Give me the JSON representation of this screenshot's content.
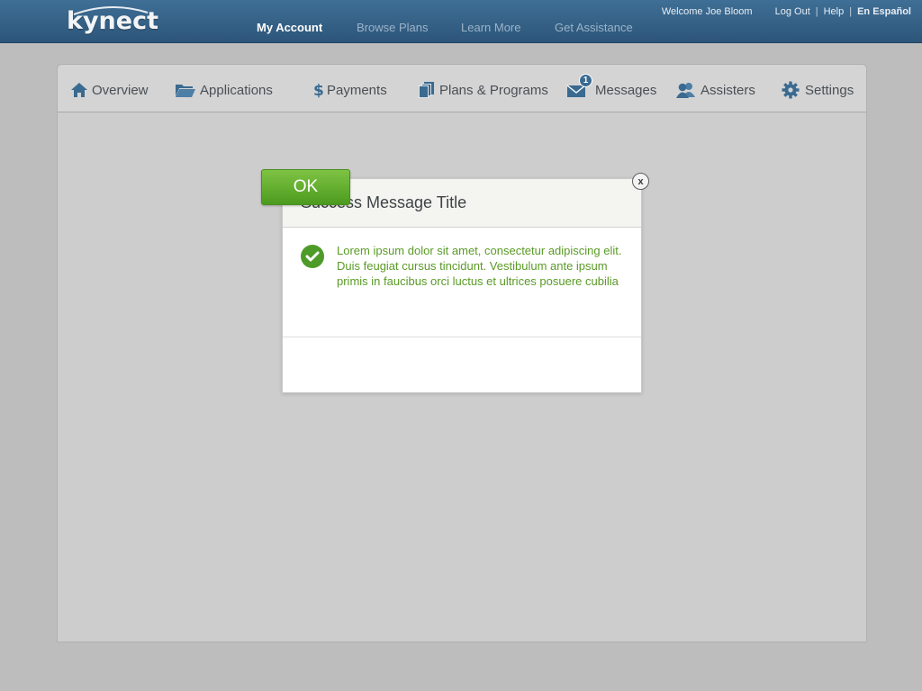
{
  "header": {
    "logo_text": "kynect",
    "nav": [
      {
        "label": "My Account",
        "active": true
      },
      {
        "label": "Browse Plans",
        "active": false
      },
      {
        "label": "Learn More",
        "active": false
      },
      {
        "label": "Get Assistance",
        "active": false
      }
    ],
    "welcome": "Welcome Joe Bloom",
    "logout": "Log Out",
    "help": "Help",
    "separator": "|",
    "language": "En Español"
  },
  "tabs": [
    {
      "label": "Overview",
      "icon": "home-icon"
    },
    {
      "label": "Applications",
      "icon": "folder-icon"
    },
    {
      "label": "Payments",
      "icon": "dollar-icon"
    },
    {
      "label": "Plans & Programs",
      "icon": "documents-icon"
    },
    {
      "label": "Messages",
      "icon": "envelope-icon",
      "badge": "1"
    },
    {
      "label": "Assisters",
      "icon": "users-icon"
    },
    {
      "label": "Settings",
      "icon": "gear-icon"
    }
  ],
  "modal": {
    "title": "Success Message Title",
    "message": "Lorem ipsum dolor sit amet, consectetur adipiscing elit. Duis feugiat cursus tincidunt. Vestibulum ante ipsum primis in faucibus orci luctus et ultrices posuere cubilia",
    "close_label": "x",
    "ok_label": "OK"
  },
  "colors": {
    "header_blue": "#2d5579",
    "success_green": "#5a9a26",
    "ok_button": "#4c9b1f"
  }
}
